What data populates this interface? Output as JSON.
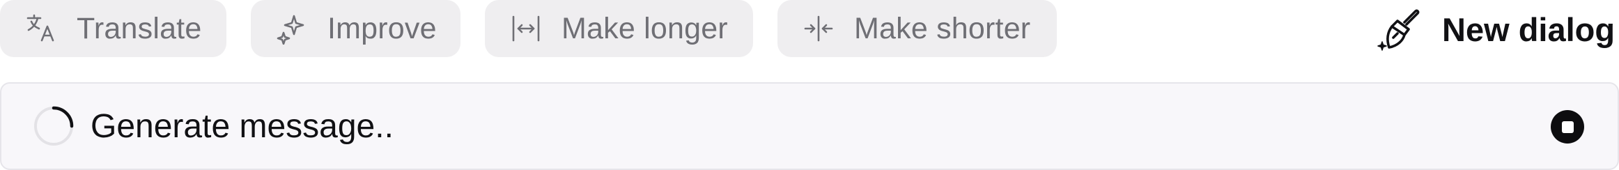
{
  "toolbar": {
    "actions": [
      {
        "label": "Translate",
        "icon": "translate-icon"
      },
      {
        "label": "Improve",
        "icon": "sparkle-icon"
      },
      {
        "label": "Make longer",
        "icon": "expand-horizontal-icon"
      },
      {
        "label": "Make shorter",
        "icon": "collapse-horizontal-icon"
      }
    ],
    "new_dialog": {
      "label": "New dialog",
      "icon": "broom-icon"
    }
  },
  "composer": {
    "status_text": "Generate message..",
    "spinner_icon": "loading-spinner-icon",
    "stop_icon": "stop-icon"
  },
  "colors": {
    "chip_background": "#efeef0",
    "chip_text": "#6f6f75",
    "bar_background": "#f8f7fa",
    "primary_text": "#111114"
  }
}
